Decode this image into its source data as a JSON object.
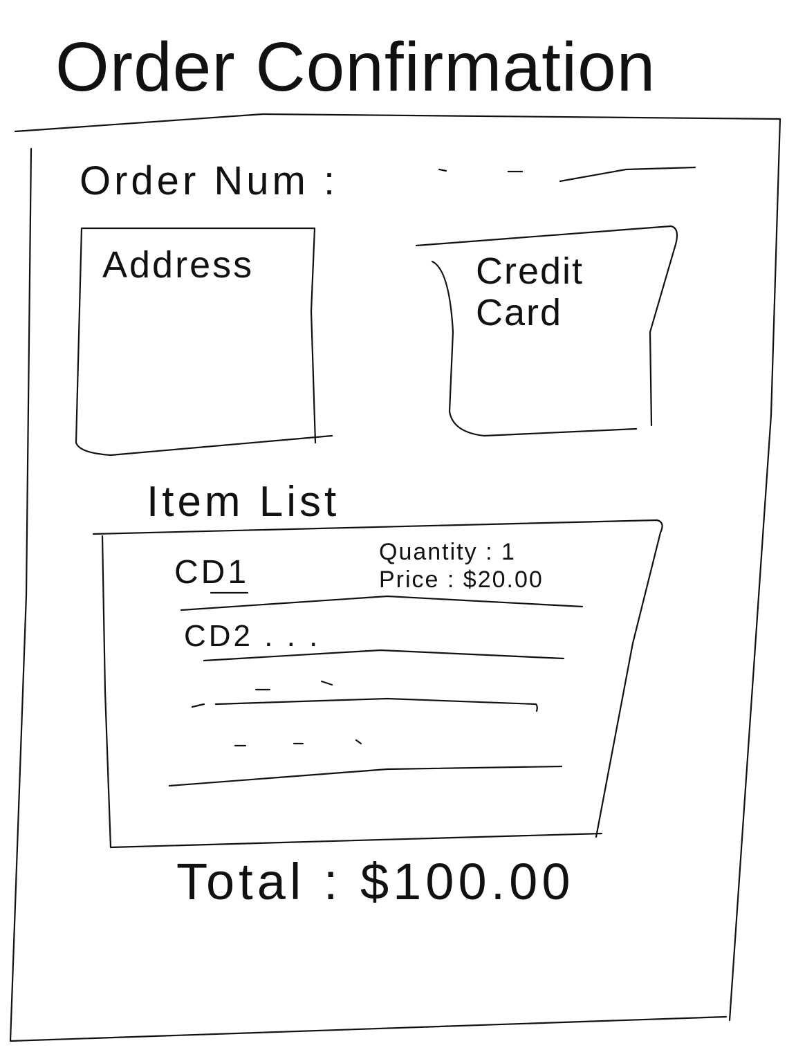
{
  "header": {
    "title": "Order Confirmation"
  },
  "order": {
    "label": "Order Num :",
    "value": "- - ——"
  },
  "address_box": {
    "label": "Address"
  },
  "credit_card_box": {
    "line1": "Credit",
    "line2": "Card"
  },
  "items": {
    "heading": "Item List",
    "rows": [
      {
        "name": "CD1",
        "quantity": "Quantity : 1",
        "price": "Price : $20.00"
      },
      {
        "name": "CD2 . . ."
      }
    ]
  },
  "total": {
    "label": "Total : $100.00"
  }
}
